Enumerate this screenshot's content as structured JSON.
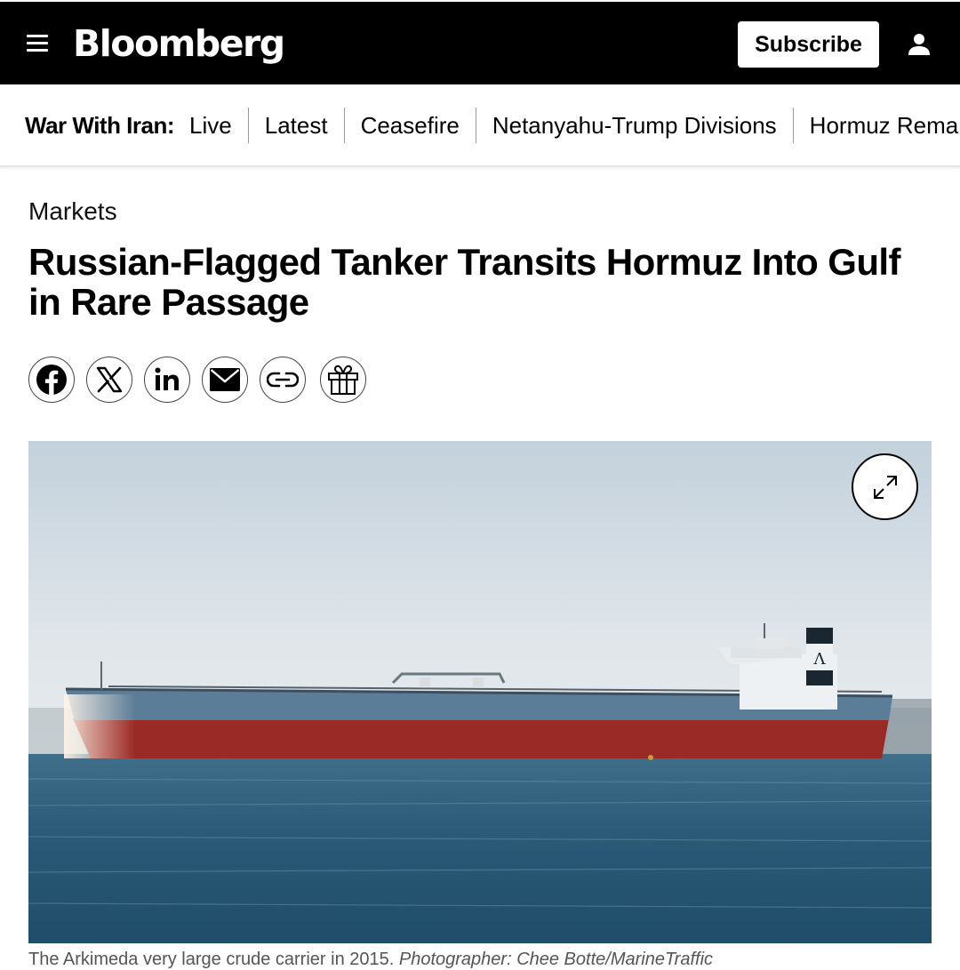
{
  "header": {
    "logo": "Bloomberg",
    "subscribe_label": "Subscribe",
    "background_color": "#000000"
  },
  "icons": {
    "menu": "hamburger-menu-icon",
    "account": "user-icon",
    "facebook": "facebook-icon",
    "x": "x-twitter-icon",
    "linkedin": "linkedin-icon",
    "email": "mail-icon",
    "link": "link-icon",
    "gift": "gift-icon",
    "expand": "expand-icon"
  },
  "topic_nav": {
    "label": "War With Iran:",
    "items": [
      {
        "label": "Live"
      },
      {
        "label": "Latest"
      },
      {
        "label": "Ceasefire"
      },
      {
        "label": "Netanyahu-Trump Divisions"
      },
      {
        "label": "Hormuz Remain"
      }
    ]
  },
  "article": {
    "section": "Markets",
    "headline": "Russian-Flagged Tanker Transits Hormuz Into Gulf in Rare Passage",
    "hero_image_description": "Photo of a large crude tanker at sea",
    "caption_text": "The Arkimeda very large crude carrier in 2015.",
    "caption_credit": "Photographer: Chee Botte/MarineTraffic"
  }
}
